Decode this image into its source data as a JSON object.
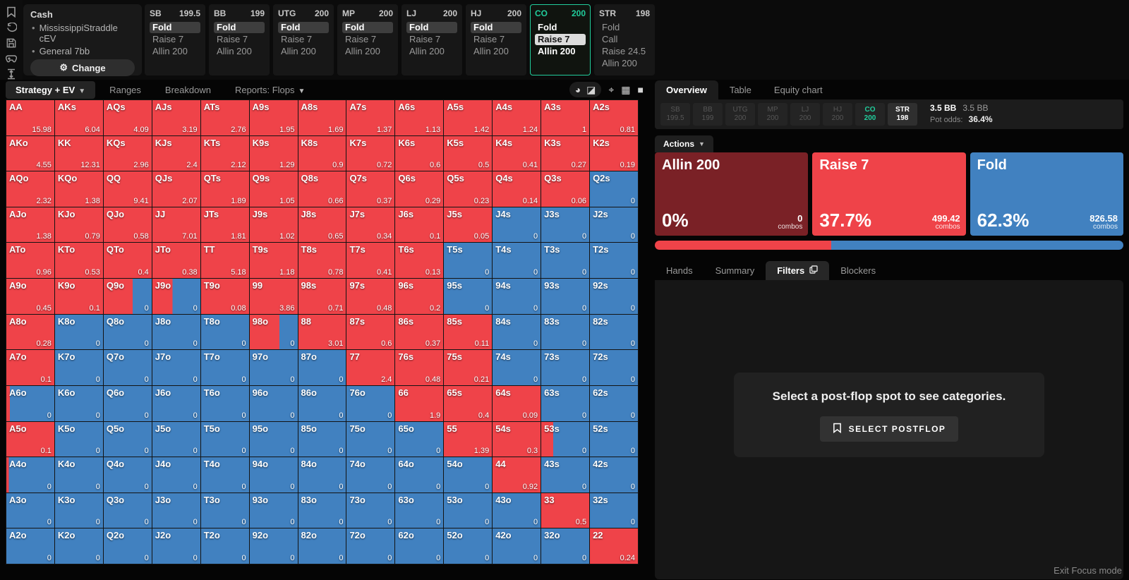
{
  "colors": {
    "red": "#ef4349",
    "blue": "#4181c0",
    "dark_red": "#7a2126",
    "teal": "#21cd9c"
  },
  "left_toolbar": {
    "icons": [
      "bookmark-icon",
      "history-icon",
      "save-icon",
      "gamepad-icon",
      "stack-depth-icon"
    ]
  },
  "session": {
    "title": "Cash",
    "lines": [
      "MississippiStraddle cEV",
      "General 7bb"
    ],
    "change_label": "Change"
  },
  "positions": [
    {
      "pos": "SB",
      "stack": "199.5",
      "active": false,
      "actions": [
        {
          "label": "Fold",
          "style": "selected-dark"
        },
        {
          "label": "Raise 7",
          "style": "plain"
        },
        {
          "label": "Allin 200",
          "style": "plain"
        }
      ]
    },
    {
      "pos": "BB",
      "stack": "199",
      "active": false,
      "actions": [
        {
          "label": "Fold",
          "style": "selected-dark"
        },
        {
          "label": "Raise 7",
          "style": "plain"
        },
        {
          "label": "Allin 200",
          "style": "plain"
        }
      ]
    },
    {
      "pos": "UTG",
      "stack": "200",
      "active": false,
      "actions": [
        {
          "label": "Fold",
          "style": "selected-dark"
        },
        {
          "label": "Raise 7",
          "style": "plain"
        },
        {
          "label": "Allin 200",
          "style": "plain"
        }
      ]
    },
    {
      "pos": "MP",
      "stack": "200",
      "active": false,
      "actions": [
        {
          "label": "Fold",
          "style": "selected-dark"
        },
        {
          "label": "Raise 7",
          "style": "plain"
        },
        {
          "label": "Allin 200",
          "style": "plain"
        }
      ]
    },
    {
      "pos": "LJ",
      "stack": "200",
      "active": false,
      "actions": [
        {
          "label": "Fold",
          "style": "selected-dark"
        },
        {
          "label": "Raise 7",
          "style": "plain"
        },
        {
          "label": "Allin 200",
          "style": "plain"
        }
      ]
    },
    {
      "pos": "HJ",
      "stack": "200",
      "active": false,
      "actions": [
        {
          "label": "Fold",
          "style": "selected-dark"
        },
        {
          "label": "Raise 7",
          "style": "plain"
        },
        {
          "label": "Allin 200",
          "style": "plain"
        }
      ]
    },
    {
      "pos": "CO",
      "stack": "200",
      "active": true,
      "actions": [
        {
          "label": "Fold",
          "style": "white"
        },
        {
          "label": "Raise 7",
          "style": "selected-light"
        },
        {
          "label": "Allin 200",
          "style": "white"
        }
      ]
    },
    {
      "pos": "STR",
      "stack": "198",
      "active": false,
      "actions": [
        {
          "label": "Fold",
          "style": "plain"
        },
        {
          "label": "Call",
          "style": "plain"
        },
        {
          "label": "Raise 24.5",
          "style": "plain"
        },
        {
          "label": "Allin 200",
          "style": "plain"
        }
      ]
    }
  ],
  "main_tabs": [
    {
      "label": "Strategy + EV",
      "caret": true,
      "active": true
    },
    {
      "label": "Ranges",
      "caret": false,
      "active": false
    },
    {
      "label": "Breakdown",
      "caret": false,
      "active": false
    },
    {
      "label": "Reports: Flops",
      "caret": true,
      "active": false
    }
  ],
  "matrix_toolbar": {
    "group_icons": [
      "pie-mode-icon",
      "split-color-mode-icon"
    ],
    "icons": [
      "recenter-icon",
      "grid-layout-icon",
      "solid-layout-icon"
    ],
    "glyphs": {
      "pie-mode-icon": "◕",
      "split-color-mode-icon": "◪",
      "recenter-icon": "⌖",
      "grid-layout-icon": "▦",
      "solid-layout-icon": "■"
    }
  },
  "right_tabs": [
    {
      "label": "Overview",
      "active": true
    },
    {
      "label": "Table",
      "active": false
    },
    {
      "label": "Equity chart",
      "active": false
    }
  ],
  "header_badges": [
    {
      "pos": "SB",
      "stack": "199.5",
      "state": "dim"
    },
    {
      "pos": "BB",
      "stack": "199",
      "state": "dim"
    },
    {
      "pos": "UTG",
      "stack": "200",
      "state": "dim"
    },
    {
      "pos": "MP",
      "stack": "200",
      "state": "dim"
    },
    {
      "pos": "LJ",
      "stack": "200",
      "state": "dim"
    },
    {
      "pos": "HJ",
      "stack": "200",
      "state": "dim"
    },
    {
      "pos": "CO",
      "stack": "200",
      "state": "hero"
    },
    {
      "pos": "STR",
      "stack": "198",
      "state": "current"
    }
  ],
  "pot_info": {
    "bb_bold": "3.5 BB",
    "bb_gray": "3.5 BB",
    "pot_odds_label": "Pot odds:",
    "pot_odds": "36.4%"
  },
  "actions_dropdown_label": "Actions",
  "action_cards": [
    {
      "label": "Allin 200",
      "pct": "0%",
      "combos": "0",
      "combos_label": "combos",
      "color_key": "dark_red"
    },
    {
      "label": "Raise 7",
      "pct": "37.7%",
      "combos": "499.42",
      "combos_label": "combos",
      "color_key": "red"
    },
    {
      "label": "Fold",
      "pct": "62.3%",
      "combos": "826.58",
      "combos_label": "combos",
      "color_key": "blue"
    }
  ],
  "strategy_bar": [
    {
      "color_key": "red",
      "pct": 37.7
    },
    {
      "color_key": "blue",
      "pct": 62.3
    }
  ],
  "sub_tabs": [
    {
      "label": "Hands",
      "active": false,
      "icon": null
    },
    {
      "label": "Summary",
      "active": false,
      "icon": null
    },
    {
      "label": "Filters",
      "active": true,
      "icon": "copy-icon"
    },
    {
      "label": "Blockers",
      "active": false,
      "icon": null
    }
  ],
  "postflop": {
    "message": "Select a post-flop spot to see categories.",
    "button_label": "SELECT POSTFLOP",
    "button_icon": "bookmark-icon"
  },
  "exit_focus": "Exit Focus mode",
  "chart_data": {
    "type": "heatmap",
    "description": "13x13 preflop hand matrix; each cell = [hand, EV, raise_fraction] where raise_fraction is the red (Raise 7) share of the cell color vs blue (Fold).",
    "rows": [
      [
        [
          "AA",
          "15.98",
          1
        ],
        [
          "AKs",
          "6.04",
          1
        ],
        [
          "AQs",
          "4.09",
          1
        ],
        [
          "AJs",
          "3.19",
          1
        ],
        [
          "ATs",
          "2.76",
          1
        ],
        [
          "A9s",
          "1.95",
          1
        ],
        [
          "A8s",
          "1.69",
          1
        ],
        [
          "A7s",
          "1.37",
          1
        ],
        [
          "A6s",
          "1.13",
          1
        ],
        [
          "A5s",
          "1.42",
          1
        ],
        [
          "A4s",
          "1.24",
          1
        ],
        [
          "A3s",
          "1",
          1
        ],
        [
          "A2s",
          "0.81",
          1
        ]
      ],
      [
        [
          "AKo",
          "4.55",
          1
        ],
        [
          "KK",
          "12.31",
          1
        ],
        [
          "KQs",
          "2.96",
          1
        ],
        [
          "KJs",
          "2.4",
          1
        ],
        [
          "KTs",
          "2.12",
          1
        ],
        [
          "K9s",
          "1.29",
          1
        ],
        [
          "K8s",
          "0.9",
          1
        ],
        [
          "K7s",
          "0.72",
          1
        ],
        [
          "K6s",
          "0.6",
          1
        ],
        [
          "K5s",
          "0.5",
          1
        ],
        [
          "K4s",
          "0.41",
          1
        ],
        [
          "K3s",
          "0.27",
          1
        ],
        [
          "K2s",
          "0.19",
          1
        ]
      ],
      [
        [
          "AQo",
          "2.32",
          1
        ],
        [
          "KQo",
          "1.38",
          1
        ],
        [
          "QQ",
          "9.41",
          1
        ],
        [
          "QJs",
          "2.07",
          1
        ],
        [
          "QTs",
          "1.89",
          1
        ],
        [
          "Q9s",
          "1.05",
          1
        ],
        [
          "Q8s",
          "0.66",
          1
        ],
        [
          "Q7s",
          "0.37",
          1
        ],
        [
          "Q6s",
          "0.29",
          1
        ],
        [
          "Q5s",
          "0.23",
          1
        ],
        [
          "Q4s",
          "0.14",
          1
        ],
        [
          "Q3s",
          "0.06",
          1
        ],
        [
          "Q2s",
          "0",
          0
        ]
      ],
      [
        [
          "AJo",
          "1.38",
          1
        ],
        [
          "KJo",
          "0.79",
          1
        ],
        [
          "QJo",
          "0.58",
          1
        ],
        [
          "JJ",
          "7.01",
          1
        ],
        [
          "JTs",
          "1.81",
          1
        ],
        [
          "J9s",
          "1.02",
          1
        ],
        [
          "J8s",
          "0.65",
          1
        ],
        [
          "J7s",
          "0.34",
          1
        ],
        [
          "J6s",
          "0.1",
          1
        ],
        [
          "J5s",
          "0.05",
          1
        ],
        [
          "J4s",
          "0",
          0
        ],
        [
          "J3s",
          "0",
          0
        ],
        [
          "J2s",
          "0",
          0
        ]
      ],
      [
        [
          "ATo",
          "0.96",
          1
        ],
        [
          "KTo",
          "0.53",
          1
        ],
        [
          "QTo",
          "0.4",
          1
        ],
        [
          "JTo",
          "0.38",
          1
        ],
        [
          "TT",
          "5.18",
          1
        ],
        [
          "T9s",
          "1.18",
          1
        ],
        [
          "T8s",
          "0.78",
          1
        ],
        [
          "T7s",
          "0.41",
          1
        ],
        [
          "T6s",
          "0.13",
          1
        ],
        [
          "T5s",
          "0",
          0
        ],
        [
          "T4s",
          "0",
          0
        ],
        [
          "T3s",
          "0",
          0
        ],
        [
          "T2s",
          "0",
          0
        ]
      ],
      [
        [
          "A9o",
          "0.45",
          1
        ],
        [
          "K9o",
          "0.1",
          1
        ],
        [
          "Q9o",
          "0",
          0.6
        ],
        [
          "J9o",
          "0",
          0.42
        ],
        [
          "T9o",
          "0.08",
          1
        ],
        [
          "99",
          "3.86",
          1
        ],
        [
          "98s",
          "0.71",
          1
        ],
        [
          "97s",
          "0.48",
          1
        ],
        [
          "96s",
          "0.2",
          1
        ],
        [
          "95s",
          "0",
          0
        ],
        [
          "94s",
          "0",
          0
        ],
        [
          "93s",
          "0",
          0
        ],
        [
          "92s",
          "0",
          0
        ]
      ],
      [
        [
          "A8o",
          "0.28",
          1
        ],
        [
          "K8o",
          "0",
          0
        ],
        [
          "Q8o",
          "0",
          0
        ],
        [
          "J8o",
          "0",
          0
        ],
        [
          "T8o",
          "0",
          0
        ],
        [
          "98o",
          "0",
          0.62
        ],
        [
          "88",
          "3.01",
          1
        ],
        [
          "87s",
          "0.6",
          1
        ],
        [
          "86s",
          "0.37",
          1
        ],
        [
          "85s",
          "0.11",
          1
        ],
        [
          "84s",
          "0",
          0
        ],
        [
          "83s",
          "0",
          0
        ],
        [
          "82s",
          "0",
          0
        ]
      ],
      [
        [
          "A7o",
          "0.1",
          1
        ],
        [
          "K7o",
          "0",
          0
        ],
        [
          "Q7o",
          "0",
          0
        ],
        [
          "J7o",
          "0",
          0
        ],
        [
          "T7o",
          "0",
          0
        ],
        [
          "97o",
          "0",
          0
        ],
        [
          "87o",
          "0",
          0
        ],
        [
          "77",
          "2.4",
          1
        ],
        [
          "76s",
          "0.48",
          1
        ],
        [
          "75s",
          "0.21",
          1
        ],
        [
          "74s",
          "0",
          0
        ],
        [
          "73s",
          "0",
          0
        ],
        [
          "72s",
          "0",
          0
        ]
      ],
      [
        [
          "A6o",
          "0",
          0.07
        ],
        [
          "K6o",
          "0",
          0
        ],
        [
          "Q6o",
          "0",
          0
        ],
        [
          "J6o",
          "0",
          0
        ],
        [
          "T6o",
          "0",
          0
        ],
        [
          "96o",
          "0",
          0
        ],
        [
          "86o",
          "0",
          0
        ],
        [
          "76o",
          "0",
          0
        ],
        [
          "66",
          "1.9",
          1
        ],
        [
          "65s",
          "0.4",
          1
        ],
        [
          "64s",
          "0.09",
          1
        ],
        [
          "63s",
          "0",
          0
        ],
        [
          "62s",
          "0",
          0
        ]
      ],
      [
        [
          "A5o",
          "0.1",
          1
        ],
        [
          "K5o",
          "0",
          0
        ],
        [
          "Q5o",
          "0",
          0
        ],
        [
          "J5o",
          "0",
          0
        ],
        [
          "T5o",
          "0",
          0
        ],
        [
          "95o",
          "0",
          0
        ],
        [
          "85o",
          "0",
          0
        ],
        [
          "75o",
          "0",
          0
        ],
        [
          "65o",
          "0",
          0
        ],
        [
          "55",
          "1.39",
          1
        ],
        [
          "54s",
          "0.3",
          1
        ],
        [
          "53s",
          "0",
          0.25
        ],
        [
          "52s",
          "0",
          0
        ]
      ],
      [
        [
          "A4o",
          "0",
          0.05
        ],
        [
          "K4o",
          "0",
          0
        ],
        [
          "Q4o",
          "0",
          0
        ],
        [
          "J4o",
          "0",
          0
        ],
        [
          "T4o",
          "0",
          0
        ],
        [
          "94o",
          "0",
          0
        ],
        [
          "84o",
          "0",
          0
        ],
        [
          "74o",
          "0",
          0
        ],
        [
          "64o",
          "0",
          0
        ],
        [
          "54o",
          "0",
          0
        ],
        [
          "44",
          "0.92",
          1
        ],
        [
          "43s",
          "0",
          0
        ],
        [
          "42s",
          "0",
          0
        ]
      ],
      [
        [
          "A3o",
          "0",
          0
        ],
        [
          "K3o",
          "0",
          0
        ],
        [
          "Q3o",
          "0",
          0
        ],
        [
          "J3o",
          "0",
          0
        ],
        [
          "T3o",
          "0",
          0
        ],
        [
          "93o",
          "0",
          0
        ],
        [
          "83o",
          "0",
          0
        ],
        [
          "73o",
          "0",
          0
        ],
        [
          "63o",
          "0",
          0
        ],
        [
          "53o",
          "0",
          0
        ],
        [
          "43o",
          "0",
          0
        ],
        [
          "33",
          "0.5",
          1
        ],
        [
          "32s",
          "0",
          0
        ]
      ],
      [
        [
          "A2o",
          "0",
          0
        ],
        [
          "K2o",
          "0",
          0
        ],
        [
          "Q2o",
          "0",
          0
        ],
        [
          "J2o",
          "0",
          0
        ],
        [
          "T2o",
          "0",
          0
        ],
        [
          "92o",
          "0",
          0
        ],
        [
          "82o",
          "0",
          0
        ],
        [
          "72o",
          "0",
          0
        ],
        [
          "62o",
          "0",
          0
        ],
        [
          "52o",
          "0",
          0
        ],
        [
          "42o",
          "0",
          0
        ],
        [
          "32o",
          "0",
          0
        ],
        [
          "22",
          "0.24",
          1
        ]
      ]
    ]
  }
}
